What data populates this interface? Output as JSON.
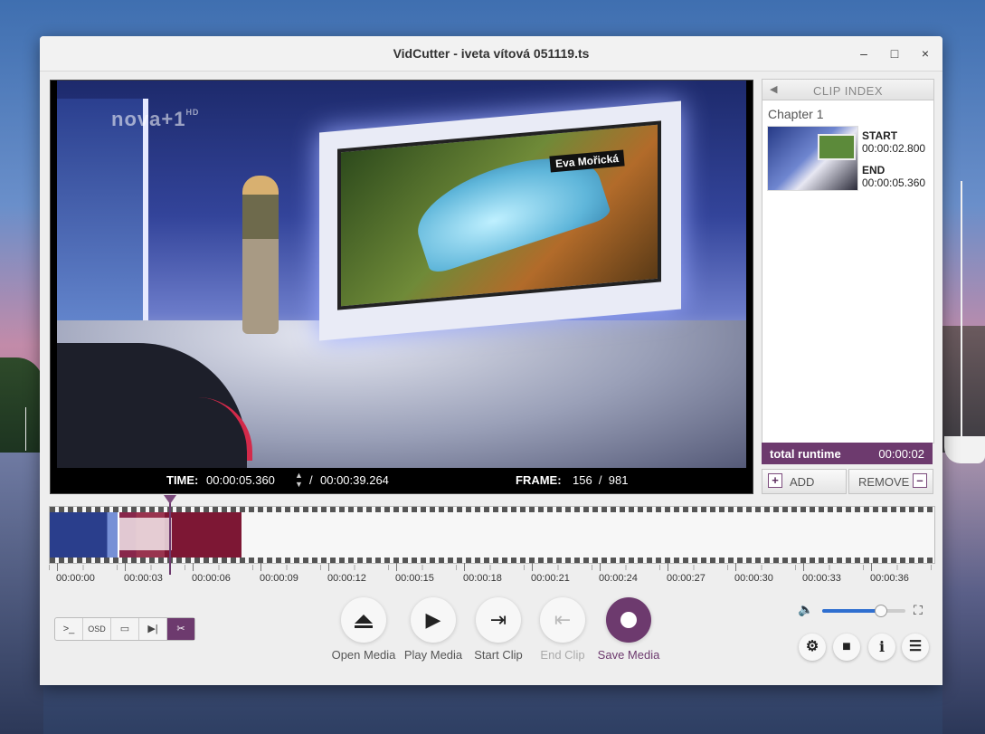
{
  "window": {
    "title": "VidCutter - iveta vítová 051119.ts"
  },
  "titlebar": {
    "minimize": "–",
    "maximize": "□",
    "close": "×"
  },
  "video": {
    "channel_logo": "nova+1",
    "channel_logo_suffix": "HD",
    "caption_tag": "Eva Mořická",
    "time_label": "TIME:",
    "time_current": "00:00:05.360",
    "time_separator": "/",
    "time_total": "00:00:39.264",
    "frame_label": "FRAME:",
    "frame_value": "156  /  981"
  },
  "clip_index": {
    "header_arrow": "◀",
    "header": "CLIP INDEX",
    "chapter": "Chapter 1",
    "clip": {
      "start_label": "START",
      "start_value": "00:00:02.800",
      "end_label": "END",
      "end_value": "00:00:05.360"
    },
    "runtime_label": "total runtime",
    "runtime_value": "00:00:02",
    "add_label": "ADD",
    "add_icon": "+",
    "remove_label": "REMOVE",
    "remove_icon": "–"
  },
  "timeline": {
    "ticks": [
      "00:00:00",
      "00:00:03",
      "00:00:06",
      "00:00:09",
      "00:00:12",
      "00:00:15",
      "00:00:18",
      "00:00:21",
      "00:00:24",
      "00:00:27",
      "00:00:30",
      "00:00:33",
      "00:00:36"
    ]
  },
  "tools": {
    "console": ">_",
    "osd": "OSD",
    "frames": "▭",
    "keyframe": "▶|",
    "cut": "✂"
  },
  "controls": {
    "open_label": "Open Media",
    "play_label": "Play Media",
    "play_icon": "▶",
    "start_label": "Start Clip",
    "start_icon": "⇥",
    "end_label": "End Clip",
    "end_icon": "⇤",
    "save_label": "Save Media"
  },
  "right_controls": {
    "volume_icon": "🔈",
    "volume_level": 0.7,
    "fullscreen_icon": "⛶",
    "settings_icon": "⚙",
    "camera_icon": "■",
    "info_icon": "i",
    "list_icon": "☰"
  },
  "colors": {
    "accent": "#6d3a6e",
    "volume": "#2f6fd0"
  }
}
